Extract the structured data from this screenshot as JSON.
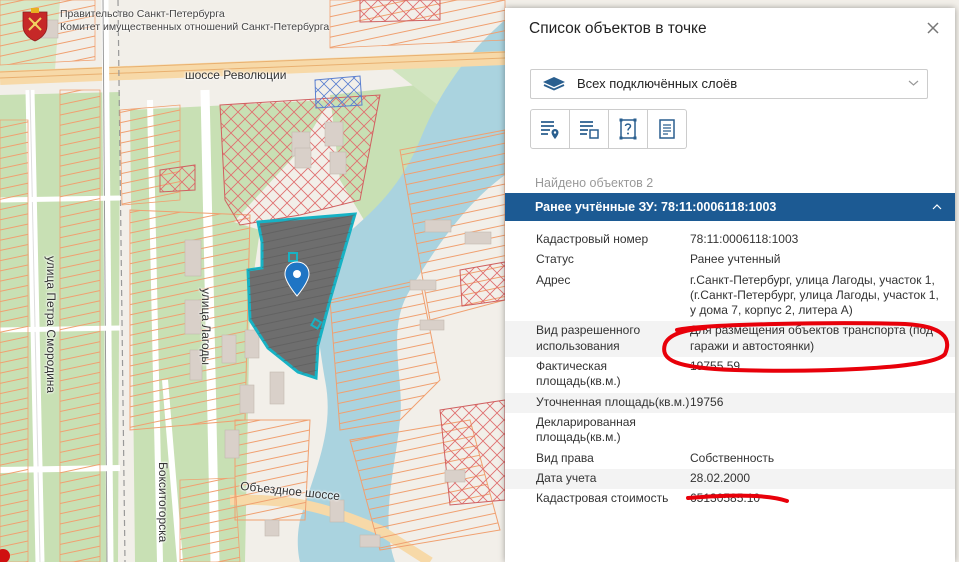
{
  "header": {
    "org_line1": "Правительство Санкт-Петербурга",
    "org_line2": "Комитет имущественных отношений Санкт-Петербурга"
  },
  "map": {
    "street_labels": {
      "revolution_highway": "шоссе Революции",
      "petra_smorodina": "улица Петра Смородина",
      "lagody": "улица Лагоды",
      "obyezdnoe": "Объездное шоссе",
      "boksitogorskaya": "Бокситогорска"
    },
    "colors": {
      "selected_parcel": "#6e6e6e",
      "selected_outline": "#17b2c4",
      "parcel_lines": "#f0a070",
      "hatch_red": "#e05050",
      "river": "#aad3df",
      "park": "#c8e0b4",
      "annotation_red": "#e8000a"
    },
    "marker_icon": "location-pin-icon",
    "emblem_icon": "coat-of-arms-icon"
  },
  "panel": {
    "title": "Список объектов в точке",
    "close_icon": "close-icon",
    "layer_select": {
      "value": "Всех подключённых слоёв",
      "icon": "layers-icon"
    },
    "tools": [
      {
        "name": "list-with-pin-icon"
      },
      {
        "name": "list-with-frame-icon"
      },
      {
        "name": "question-frame-icon"
      },
      {
        "name": "document-icon"
      }
    ],
    "found_text": "Найдено объектов 2",
    "result": {
      "title": "Ранее учтённые ЗУ: 78:11:0006118:1003",
      "accent": "#1c5a93",
      "rows": [
        {
          "key": "Кадастровый номер",
          "value": "78:11:0006118:1003"
        },
        {
          "key": "Статус",
          "value": "Ранее учтенный"
        },
        {
          "key": "Адрес",
          "value": "г.Санкт-Петербург, улица Лагоды, участок 1, (г.Санкт-Петербург, улица Лагоды, участок 1, у дома 7, корпус 2, литера А)"
        },
        {
          "key": "Вид разрешенного использования",
          "value": "Для размещения объектов транспорта (под гаражи и автостоянки)"
        },
        {
          "key": "Фактическая площадь(кв.м.)",
          "value": "19755.59"
        },
        {
          "key": "Уточненная площадь(кв.м.)",
          "value": "19756"
        },
        {
          "key": "Декларированная площадь(кв.м.)",
          "value": ""
        },
        {
          "key": "Вид права",
          "value": "Собственность"
        },
        {
          "key": "Дата учета",
          "value": "28.02.2000"
        },
        {
          "key": "Кадастровая стоимость",
          "value": "65130585.10"
        }
      ]
    }
  }
}
